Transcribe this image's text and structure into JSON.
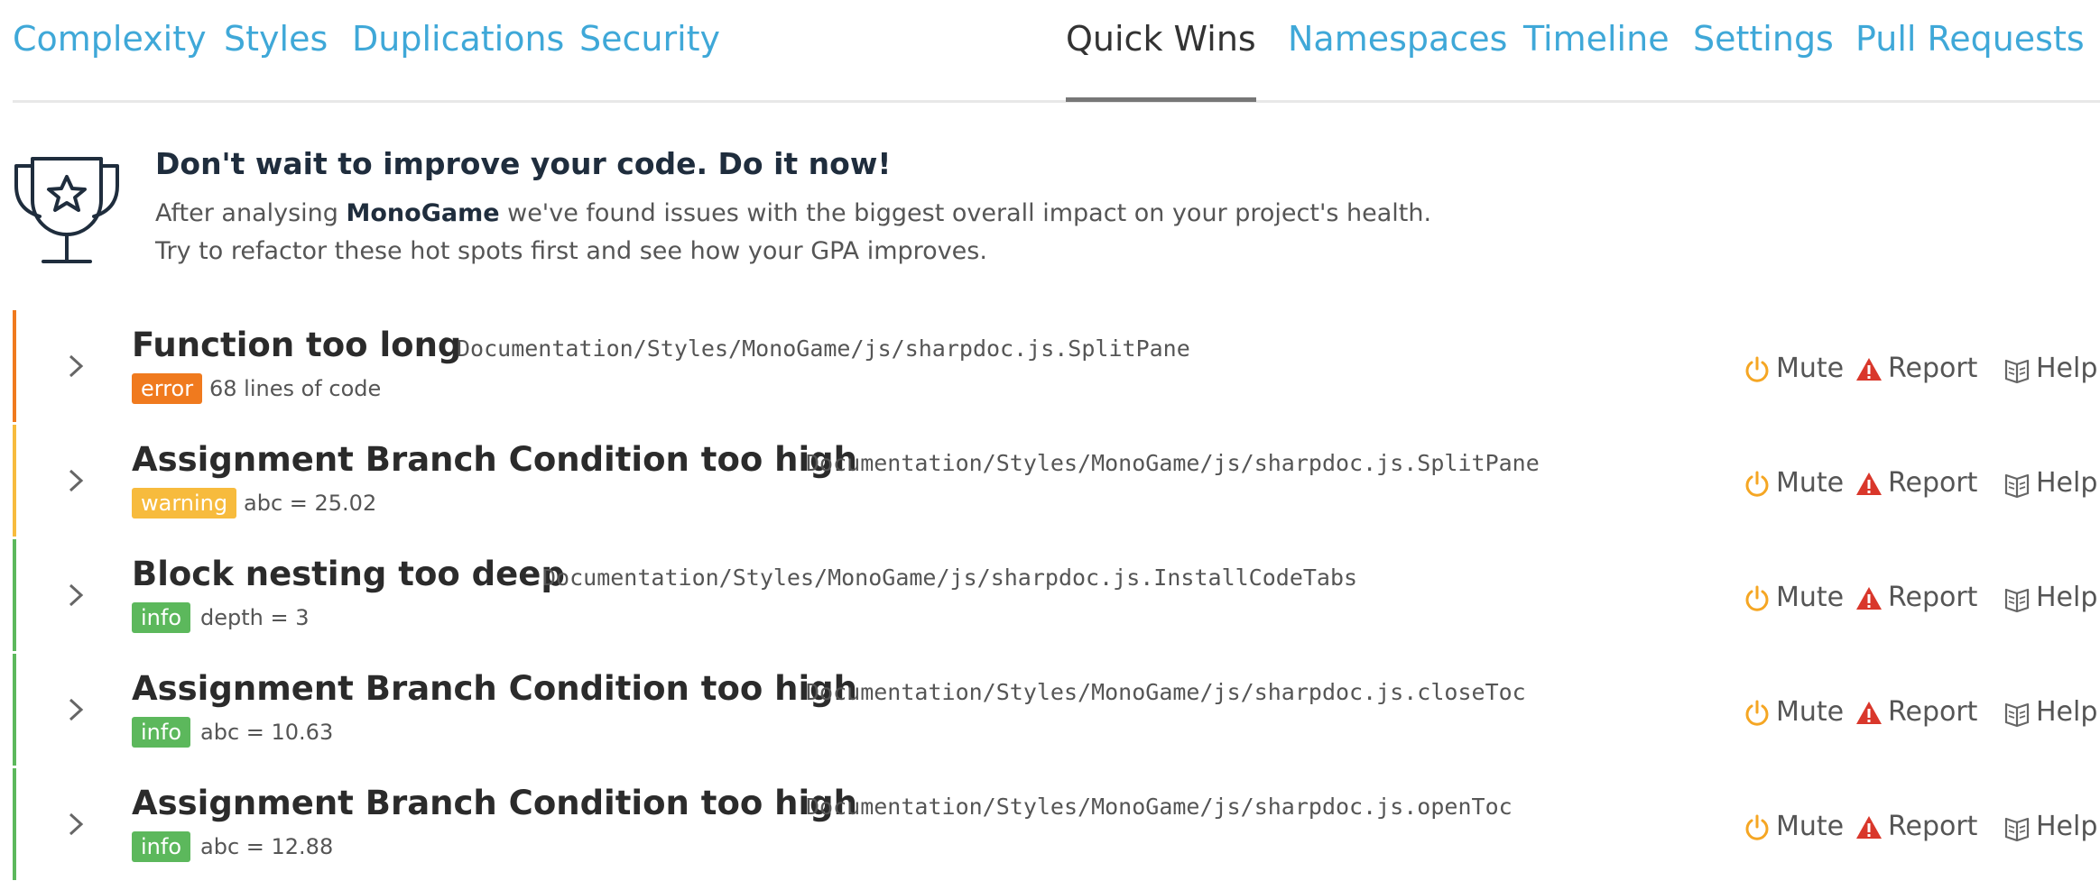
{
  "nav": {
    "tabs": [
      {
        "label": "Complexity"
      },
      {
        "label": "Styles"
      },
      {
        "label": "Duplications"
      },
      {
        "label": "Security"
      },
      {
        "label": "Quick Wins",
        "active": true
      },
      {
        "label": "Namespaces"
      },
      {
        "label": "Timeline"
      },
      {
        "label": "Settings"
      },
      {
        "label": "Pull Requests"
      }
    ]
  },
  "intro": {
    "heading": "Don't wait to improve your code. Do it now!",
    "line1_prefix": "After analysing ",
    "project": "MonoGame",
    "line1_suffix": " we've found issues with the biggest overall impact on your project's health.",
    "line2": "Try to refactor these hot spots first and see how your GPA improves."
  },
  "actions": {
    "mute": "Mute",
    "report": "Report",
    "help": "Help"
  },
  "colors": {
    "link": "#3fa8d8",
    "error": "#f07a1e",
    "warning": "#f7bb3d",
    "info": "#5cb85c",
    "mute_icon": "#f5a623",
    "report_icon": "#d9372b"
  },
  "issues": [
    {
      "title": "Function too long",
      "path": "Documentation/Styles/MonoGame/js/sharpdoc.js.SplitPane",
      "severity": "error",
      "metric": "68 lines of code"
    },
    {
      "title": "Assignment Branch Condition too high",
      "path": "Documentation/Styles/MonoGame/js/sharpdoc.js.SplitPane",
      "severity": "warning",
      "metric": "abc = 25.02"
    },
    {
      "title": "Block nesting too deep",
      "path": "Documentation/Styles/MonoGame/js/sharpdoc.js.InstallCodeTabs",
      "severity": "info",
      "metric": "depth = 3"
    },
    {
      "title": "Assignment Branch Condition too high",
      "path": "Documentation/Styles/MonoGame/js/sharpdoc.js.closeToc",
      "severity": "info",
      "metric": "abc = 10.63"
    },
    {
      "title": "Assignment Branch Condition too high",
      "path": "Documentation/Styles/MonoGame/js/sharpdoc.js.openToc",
      "severity": "info",
      "metric": "abc = 12.88"
    }
  ]
}
